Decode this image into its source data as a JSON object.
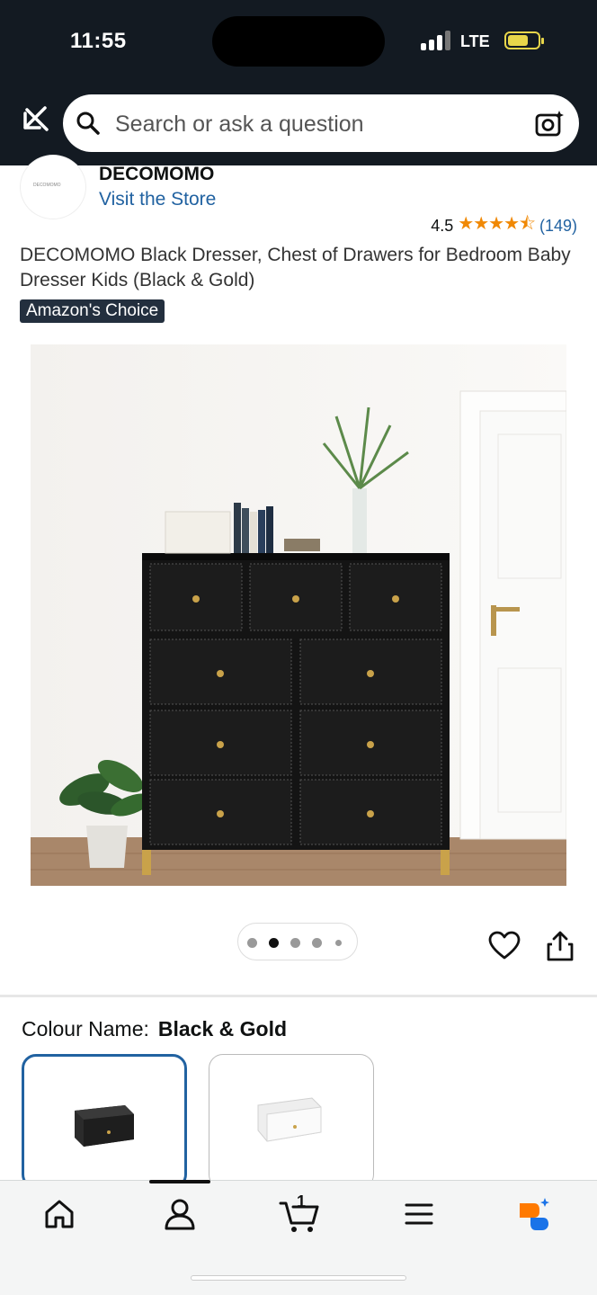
{
  "status_bar": {
    "time": "11:55",
    "network": "LTE"
  },
  "search": {
    "placeholder": "Search or ask a question"
  },
  "store": {
    "logo_text": "DECOMOMO",
    "brand": "DECOMOMO",
    "visit_label": "Visit the Store"
  },
  "rating": {
    "value": "4.5",
    "stars_display": "★★★★⯪",
    "count": "(149)"
  },
  "product": {
    "title": "DECOMOMO Black Dresser, Chest of Drawers for Bedroom Baby Dresser Kids (Black & Gold)",
    "badge": "Amazon's Choice",
    "image_index": 2,
    "image_count": 5
  },
  "variation": {
    "label": "Colour Name:",
    "selected": "Black & Gold"
  },
  "nav": {
    "items": [
      "home-icon",
      "account-icon",
      "cart-icon",
      "menu-icon",
      "rufus-icon"
    ],
    "cart_count": "1"
  },
  "colors": {
    "header": "#131a22",
    "link": "#2162a1",
    "star": "#f08804",
    "badge": "#232f3e"
  }
}
